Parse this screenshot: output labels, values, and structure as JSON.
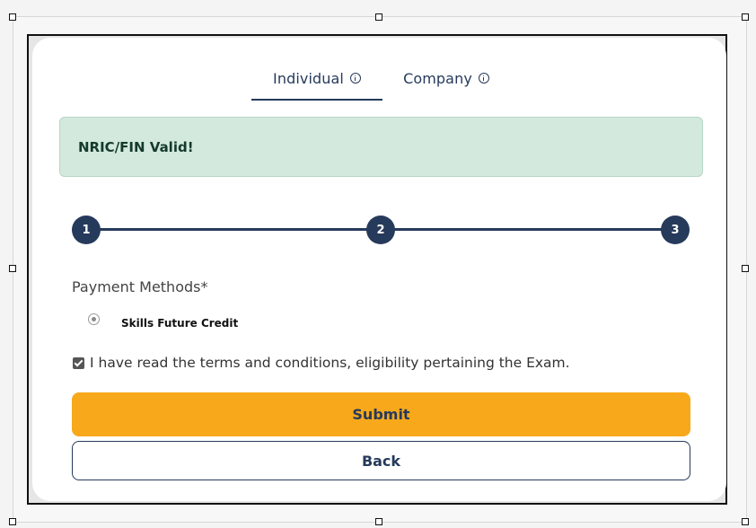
{
  "tabs": [
    {
      "label": "Individual",
      "active": true
    },
    {
      "label": "Company",
      "active": false
    }
  ],
  "alert": {
    "text": "NRIC/FIN Valid!",
    "color": "#d3e9de"
  },
  "stepper": {
    "steps": [
      "1",
      "2",
      "3"
    ],
    "color": "#263a5b"
  },
  "payment": {
    "label": "Payment Methods*",
    "options": [
      {
        "label": "Skills Future Credit",
        "selected": true
      }
    ]
  },
  "terms": {
    "label": "I have read the terms and conditions, eligibility pertaining the Exam.",
    "checked": true
  },
  "buttons": {
    "submit": "Submit",
    "back": "Back"
  },
  "colors": {
    "accent": "#f7a81b",
    "primary": "#263a5b"
  }
}
